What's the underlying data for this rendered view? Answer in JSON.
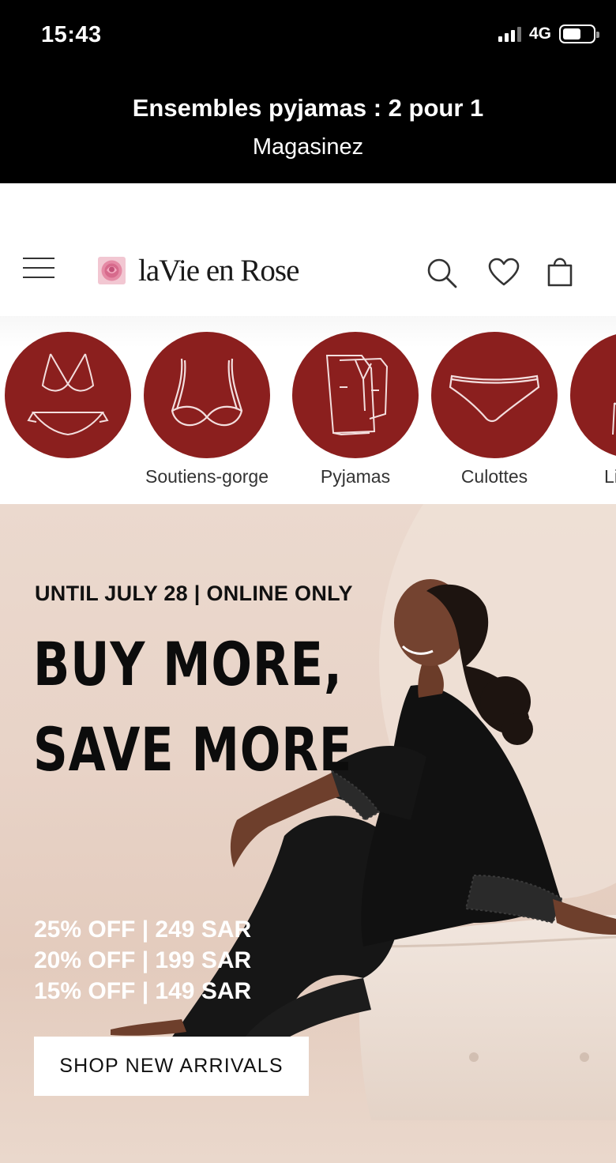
{
  "status_bar": {
    "time": "15:43",
    "network": "4G"
  },
  "promo": {
    "headline": "Ensembles pyjamas : 2 pour 1",
    "link": "Magasinez"
  },
  "header": {
    "brand": "laVie en Rose"
  },
  "categories": [
    {
      "label": ""
    },
    {
      "label": "Soutiens-gorge"
    },
    {
      "label": "Pyjamas"
    },
    {
      "label": "Culottes"
    },
    {
      "label": "Li"
    }
  ],
  "hero": {
    "kicker": "UNTIL JULY 28 | ONLINE ONLY",
    "title_line1": "BUY MORE,",
    "title_line2": "SAVE MORE",
    "offers": [
      "25% OFF | 249 SAR",
      "20% OFF | 199 SAR",
      "15% OFF | 149 SAR"
    ],
    "cta": "SHOP NEW ARRIVALS"
  },
  "colors": {
    "brand_red": "#8b1f1e",
    "promo_bg": "#000000",
    "hero_bg": "#e8d3c7"
  }
}
